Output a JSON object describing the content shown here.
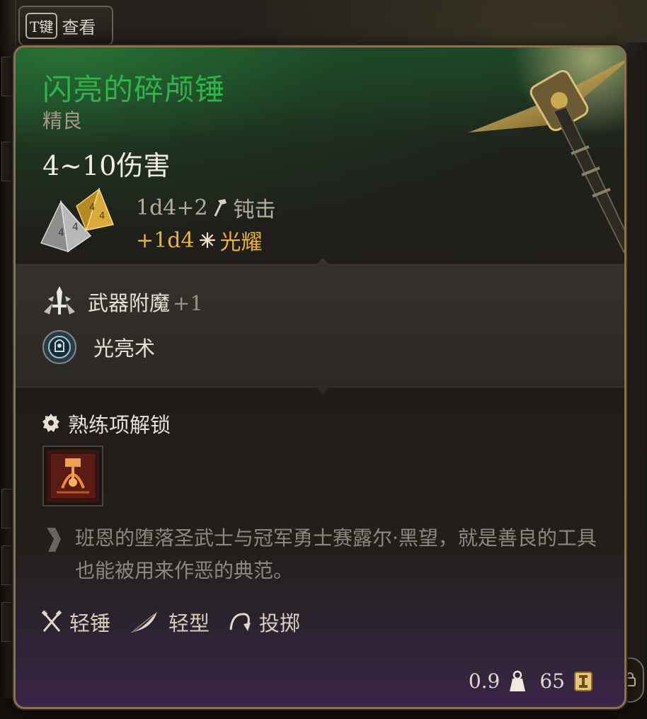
{
  "hotkey": {
    "key": "T键",
    "label": "查看"
  },
  "item": {
    "name": "闪亮的碎颅锤",
    "rarity": "精良",
    "damage_total": "4~10伤害",
    "damage_lines": [
      {
        "dice": "1d4+2",
        "type": "钝击",
        "icon": "hammer-icon"
      },
      {
        "dice": "+1d4",
        "type": "光耀",
        "icon": "radiant-icon"
      }
    ],
    "enchantment": {
      "label": "武器附魔",
      "value": "+1"
    },
    "spell": {
      "label": "光亮术"
    },
    "proficiency_header": "熟练项解锁",
    "flavor": "班恩的堕落圣武士与冠军勇士赛露尔·黑望，就是善良的工具也能被用来作恶的典范。",
    "properties": [
      {
        "label": "轻锤",
        "icon": "crossed-weapons-icon"
      },
      {
        "label": "轻型",
        "icon": "feather-icon"
      },
      {
        "label": "投掷",
        "icon": "throw-icon"
      }
    ],
    "weight": "0.9",
    "value": "65"
  },
  "colors": {
    "title_green": "#2fb44a",
    "radiant_gold": "#e8b23c",
    "border": "#8a7250"
  }
}
